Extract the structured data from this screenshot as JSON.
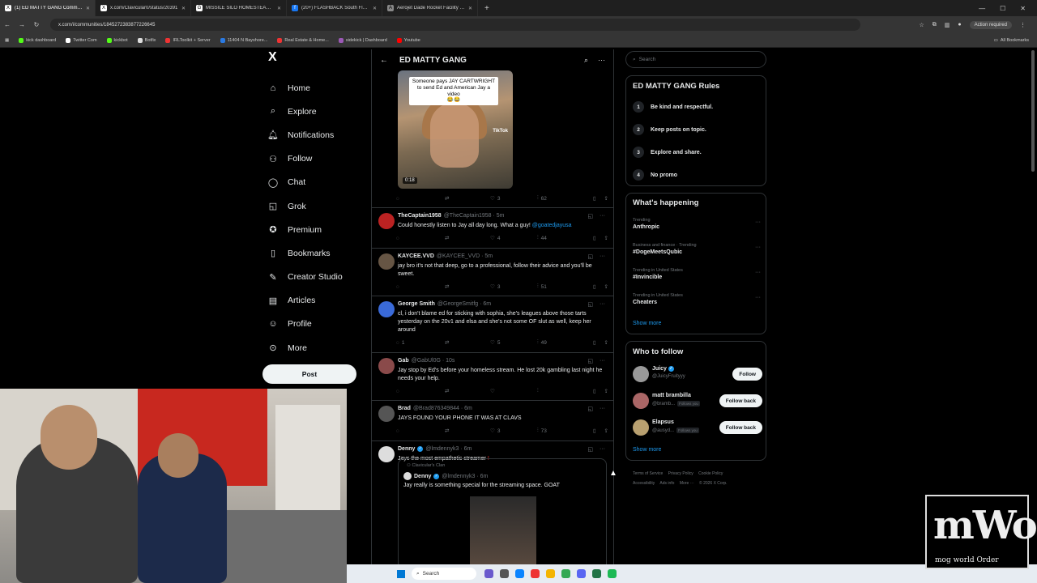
{
  "browser": {
    "tabs": [
      {
        "title": "(1) ED MATTY GANG Community",
        "fav": "X",
        "active": true
      },
      {
        "title": "x.com/Clavicular0/status/20391",
        "fav": "X",
        "active": false
      },
      {
        "title": "MISSILE SILO HOMESTEAD - Go",
        "fav": "G",
        "active": false
      },
      {
        "title": "(20+) FLASHBACK South Florida",
        "fav": "f",
        "active": false
      },
      {
        "title": "Aerojet Dade Rocket Facility | A",
        "fav": "A",
        "active": false
      }
    ],
    "url": "x.com/i/communities/1845272383877226645",
    "action_required": "Action required",
    "bookmarks": [
      "kick dashboard",
      "Twitter Com",
      "kickbot",
      "Botfix",
      "IRLToolkit + Server",
      "11404 N Bayshore...",
      "Real Estate & Home...",
      "sidekick | Dashboard",
      "Youtube"
    ],
    "all_bookmarks": "All Bookmarks"
  },
  "leftnav": {
    "logo": "X",
    "items": [
      "Home",
      "Explore",
      "Notifications",
      "Follow",
      "Chat",
      "Grok",
      "Premium",
      "Bookmarks",
      "Creator Studio",
      "Articles",
      "Profile",
      "More"
    ],
    "icons": [
      "home-icon",
      "search-icon",
      "bell-icon",
      "follow-icon",
      "chat-icon",
      "grok-icon",
      "premium-icon",
      "bookmark-icon",
      "creator-studio-icon",
      "articles-icon",
      "profile-icon",
      "more-icon"
    ],
    "post_label": "Post"
  },
  "header": {
    "title": "ED MATTY GANG"
  },
  "video_post": {
    "caption": "Someone pays JAY CARTWRIGHT to send Ed and American Jay a video",
    "caption_emoji": "😂😂",
    "tiktok": "TikTok",
    "duration": "0:18",
    "likes": "3",
    "views": "62"
  },
  "tweets": [
    {
      "name": "TheCaptain1958",
      "handle": "@TheCaptain1958 · 5m",
      "text": "Could honestly listen to Jay all day long. What a guy!",
      "mention": "@goatedjayusa",
      "replies": "",
      "likes": "4",
      "views": "44"
    },
    {
      "name": "KAYCEE.VVD",
      "handle": "@KAYCEE_VVD · 5m",
      "text": "jay bro it's not that deep, go to a professional, follow their advice and you'll be sweet.",
      "mention": "",
      "replies": "",
      "likes": "3",
      "views": "51"
    },
    {
      "name": "George Smith",
      "handle": "@GeorgeSmitfg · 6m",
      "text": "cl, i don't blame ed for sticking with sophia, she's leagues above those tarts yesterday on the 20v1 and elsa and she's not some OF slut as well, keep her around",
      "mention": "",
      "replies": "1",
      "likes": "5",
      "views": "49"
    },
    {
      "name": "Gab",
      "handle": "@GabUl0G · 10s",
      "text": "Jay stop by Ed's before your homeless stream. He lost 20k gambling last night he needs your help.",
      "mention": "",
      "replies": "",
      "likes": "",
      "views": ""
    },
    {
      "name": "Brad",
      "handle": "@Brad876349844 · 6m",
      "text": "JAYS FOUND YOUR PHONE IT WAS AT CLAVS",
      "mention": "",
      "replies": "",
      "likes": "3",
      "views": "73"
    },
    {
      "name": "Denny",
      "handle": "@lmdennyk3 · 6m",
      "text": "Jays the most empathetic streamer",
      "mention": "",
      "replies": "",
      "likes": "",
      "views": ""
    }
  ],
  "quote": {
    "community": "Clavicular's Clan",
    "name": "Denny",
    "handle": "@lmdennyk3 · 6m",
    "text": "Jay really is something special for the streaming space. GOAT"
  },
  "right": {
    "search_placeholder": "Search",
    "rules_title": "ED MATTY GANG Rules",
    "rules": [
      {
        "num": "1",
        "text": "Be kind and respectful."
      },
      {
        "num": "2",
        "text": "Keep posts on topic."
      },
      {
        "num": "3",
        "text": "Explore and share."
      },
      {
        "num": "4",
        "text": "No promo"
      }
    ],
    "happening_title": "What's happening",
    "trends": [
      {
        "cat": "Trending",
        "name": "Anthropic"
      },
      {
        "cat": "Business and finance · Trending",
        "name": "#DogeMeetsQubic"
      },
      {
        "cat": "Trending in United States",
        "name": "#Invincible"
      },
      {
        "cat": "Trending in United States",
        "name": "Cheaters"
      }
    ],
    "show_more": "Show more",
    "wtf_title": "Who to follow",
    "follows": [
      {
        "name": "Juicy",
        "handle": "@JuicyFruityyy",
        "btn": "Follow",
        "follows_you": ""
      },
      {
        "name": "matt brambilla",
        "handle": "@bramb...",
        "btn": "Follow back",
        "follows_you": "Follows you"
      },
      {
        "name": "Elapsus",
        "handle": "@ausyd...",
        "btn": "Follow back",
        "follows_you": "Follows you"
      }
    ],
    "footer": [
      "Terms of Service",
      "Privacy Policy",
      "Cookie Policy",
      "Accessibility",
      "Ads info",
      "More ···",
      "© 2026 X Corp."
    ]
  },
  "taskbar": {
    "search": "Search"
  },
  "overlay": {
    "logo_big": "mWo",
    "logo_small": "mog world Order"
  },
  "colors": {
    "accent": "#1d9bf0",
    "background": "#000000",
    "border": "#2f3336"
  }
}
